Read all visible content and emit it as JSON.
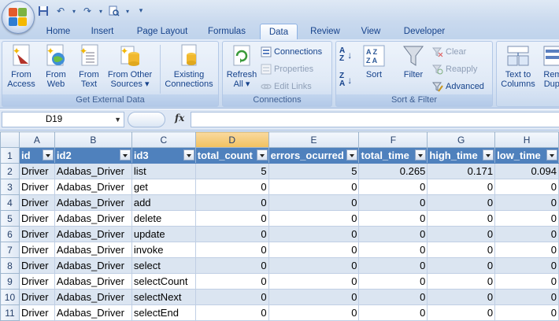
{
  "tabs": [
    "Home",
    "Insert",
    "Page Layout",
    "Formulas",
    "Data",
    "Review",
    "View",
    "Developer"
  ],
  "active_tab": "Data",
  "ribbon": {
    "get_external": {
      "label": "Get External Data",
      "from_access": [
        "From",
        "Access"
      ],
      "from_web": [
        "From",
        "Web"
      ],
      "from_text": [
        "From",
        "Text"
      ],
      "from_other": [
        "From Other",
        "Sources ▾"
      ],
      "existing": [
        "Existing",
        "Connections"
      ]
    },
    "connections": {
      "label": "Connections",
      "refresh": [
        "Refresh",
        "All ▾"
      ],
      "connections": "Connections",
      "properties": "Properties",
      "edit_links": "Edit Links"
    },
    "sort_filter": {
      "label": "Sort & Filter",
      "sort": "Sort",
      "filter": "Filter",
      "clear": "Clear",
      "reapply": "Reapply",
      "advanced": "Advanced"
    },
    "data_tools": {
      "text_to_columns": [
        "Text to",
        "Columns"
      ],
      "remove_dup": [
        "Rem",
        "Dupl"
      ]
    }
  },
  "formula_bar": {
    "name_box": "D19",
    "fx": "fx",
    "formula": ""
  },
  "columns": [
    "A",
    "B",
    "C",
    "D",
    "E",
    "F",
    "G",
    "H"
  ],
  "selected_column": "D",
  "header_row": {
    "row_number": "1",
    "cells": [
      "id",
      "id2",
      "id3",
      "total_count",
      "errors_ocurred",
      "total_time",
      "high_time",
      "low_time"
    ]
  },
  "rows": [
    {
      "n": "2",
      "cells": [
        "Driver",
        "Adabas_Driver",
        "list",
        "5",
        "5",
        "0.265",
        "0.171",
        "0.094"
      ]
    },
    {
      "n": "3",
      "cells": [
        "Driver",
        "Adabas_Driver",
        "get",
        "0",
        "0",
        "0",
        "0",
        "0"
      ]
    },
    {
      "n": "4",
      "cells": [
        "Driver",
        "Adabas_Driver",
        "add",
        "0",
        "0",
        "0",
        "0",
        "0"
      ]
    },
    {
      "n": "5",
      "cells": [
        "Driver",
        "Adabas_Driver",
        "delete",
        "0",
        "0",
        "0",
        "0",
        "0"
      ]
    },
    {
      "n": "6",
      "cells": [
        "Driver",
        "Adabas_Driver",
        "update",
        "0",
        "0",
        "0",
        "0",
        "0"
      ]
    },
    {
      "n": "7",
      "cells": [
        "Driver",
        "Adabas_Driver",
        "invoke",
        "0",
        "0",
        "0",
        "0",
        "0"
      ]
    },
    {
      "n": "8",
      "cells": [
        "Driver",
        "Adabas_Driver",
        "select",
        "0",
        "0",
        "0",
        "0",
        "0"
      ]
    },
    {
      "n": "9",
      "cells": [
        "Driver",
        "Adabas_Driver",
        "selectCount",
        "0",
        "0",
        "0",
        "0",
        "0"
      ]
    },
    {
      "n": "10",
      "cells": [
        "Driver",
        "Adabas_Driver",
        "selectNext",
        "0",
        "0",
        "0",
        "0",
        "0"
      ]
    },
    {
      "n": "11",
      "cells": [
        "Driver",
        "Adabas_Driver",
        "selectEnd",
        "0",
        "0",
        "0",
        "0",
        "0"
      ]
    }
  ],
  "colors": {
    "table_header": "#4f81bd",
    "band": "#dbe5f1",
    "selected_col_header": "#f1c15f"
  }
}
